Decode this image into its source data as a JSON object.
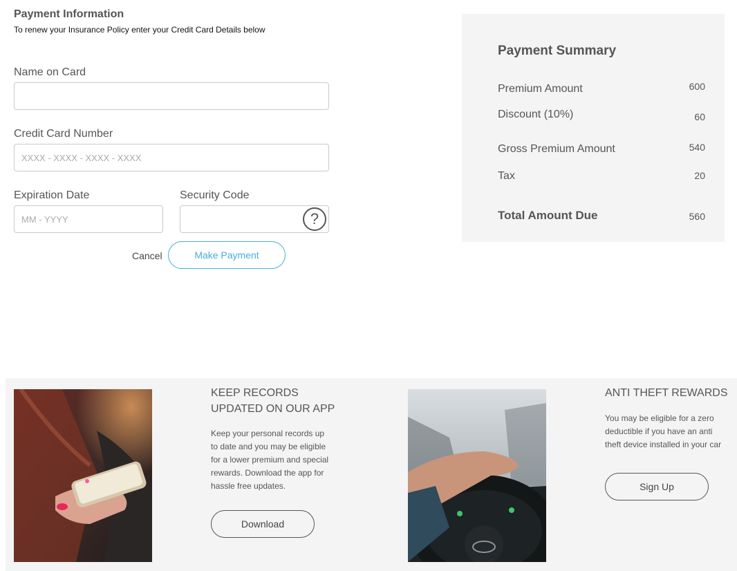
{
  "form": {
    "title": "Payment Information",
    "subtitle": "To renew your Insurance Policy enter your Credit Card Details below",
    "name_label": "Name on Card",
    "name_value": "",
    "card_label": "Credit Card Number",
    "card_placeholder": "XXXX - XXXX - XXXX - XXXX",
    "expiry_label": "Expiration Date",
    "expiry_placeholder": "MM - YYYY",
    "security_label": "Security Code",
    "help_icon": "?",
    "cancel_label": "Cancel",
    "submit_label": "Make Payment"
  },
  "summary": {
    "title": "Payment Summary",
    "premium_label": "Premium Amount",
    "premium_value": "600",
    "discount_label": "Discount (10%)",
    "discount_value": "60",
    "gross_label": "Gross Premium Amount",
    "gross_value": "540",
    "tax_label": "Tax",
    "tax_value": "20",
    "total_label": "Total Amount Due",
    "total_value": "560"
  },
  "promos": [
    {
      "heading": "KEEP RECORDS\nUPDATED ON OUR APP",
      "body": "Keep your personal records up to date and you may be eligible for a lower premium and special rewards. Download the app for hassle free updates.",
      "button": "Download",
      "image": "phone-in-hand-photo"
    },
    {
      "heading": "ANTI THEFT REWARDS",
      "body": "You may be eligible for a zero deductible if you have an anti theft device installed in your car",
      "button": "Sign Up",
      "image": "steering-wheel-photo"
    }
  ],
  "colors": {
    "accent": "#45aee0",
    "panel_bg": "#f4f4f4",
    "text": "#555555"
  }
}
